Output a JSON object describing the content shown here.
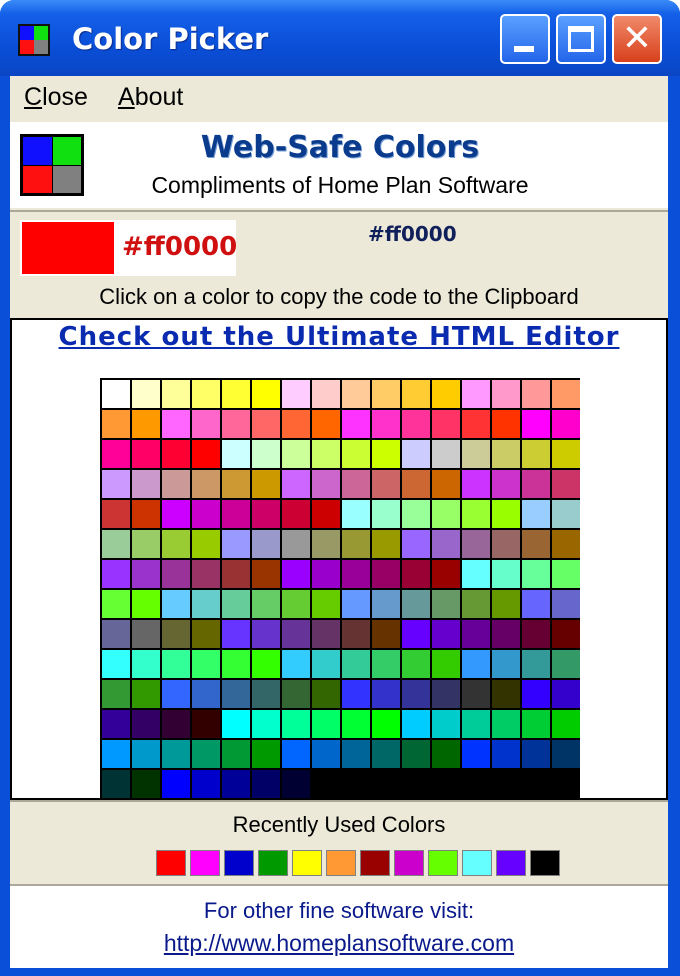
{
  "window": {
    "title": "Color Picker"
  },
  "menu": {
    "close": "Close",
    "about": "About"
  },
  "header": {
    "title": "Web-Safe Colors",
    "subtitle": "Compliments of Home Plan Software"
  },
  "current": {
    "color": "#ff0000",
    "hex_label": "#ff0000",
    "hex_label_alt": "#ff0000"
  },
  "instruction": "Click on a color to copy the code to the Clipboard",
  "promo_link": "Check out the Ultimate HTML Editor",
  "palette": {
    "rows": [
      [
        "#ffffff",
        "#ffffcc",
        "#ffff99",
        "#ffff66",
        "#ffff33",
        "#ffff00",
        "#ffccff",
        "#ffcccc",
        "#ffcc99",
        "#ffcc66",
        "#ffcc33",
        "#ffcc00",
        "#ff99ff",
        "#ff99cc",
        "#ff9999",
        "#ff9966"
      ],
      [
        "#ff9933",
        "#ff9900",
        "#ff66ff",
        "#ff66cc",
        "#ff6699",
        "#ff6666",
        "#ff6633",
        "#ff6600",
        "#ff33ff",
        "#ff33cc",
        "#ff3399",
        "#ff3366",
        "#ff3333",
        "#ff3300",
        "#ff00ff",
        "#ff00cc"
      ],
      [
        "#ff0099",
        "#ff0066",
        "#ff0033",
        "#ff0000",
        "#ccffff",
        "#ccffcc",
        "#ccff99",
        "#ccff66",
        "#ccff33",
        "#ccff00",
        "#ccccff",
        "#cccccc",
        "#cccc99",
        "#cccc66",
        "#cccc33",
        "#cccc00"
      ],
      [
        "#cc99ff",
        "#cc99cc",
        "#cc9999",
        "#cc9966",
        "#cc9933",
        "#cc9900",
        "#cc66ff",
        "#cc66cc",
        "#cc6699",
        "#cc6666",
        "#cc6633",
        "#cc6600",
        "#cc33ff",
        "#cc33cc",
        "#cc3399",
        "#cc3366"
      ],
      [
        "#cc3333",
        "#cc3300",
        "#cc00ff",
        "#cc00cc",
        "#cc0099",
        "#cc0066",
        "#cc0033",
        "#cc0000",
        "#99ffff",
        "#99ffcc",
        "#99ff99",
        "#99ff66",
        "#99ff33",
        "#99ff00",
        "#99ccff",
        "#99cccc"
      ],
      [
        "#99cc99",
        "#99cc66",
        "#99cc33",
        "#99cc00",
        "#9999ff",
        "#9999cc",
        "#999999",
        "#999966",
        "#999933",
        "#999900",
        "#9966ff",
        "#9966cc",
        "#996699",
        "#996666",
        "#996633",
        "#996600"
      ],
      [
        "#9933ff",
        "#9933cc",
        "#993399",
        "#993366",
        "#993333",
        "#993300",
        "#9900ff",
        "#9900cc",
        "#990099",
        "#990066",
        "#990033",
        "#990000",
        "#66ffff",
        "#66ffcc",
        "#66ff99",
        "#66ff66"
      ],
      [
        "#66ff33",
        "#66ff00",
        "#66ccff",
        "#66cccc",
        "#66cc99",
        "#66cc66",
        "#66cc33",
        "#66cc00",
        "#6699ff",
        "#6699cc",
        "#669999",
        "#669966",
        "#669933",
        "#669900",
        "#6666ff",
        "#6666cc"
      ],
      [
        "#666699",
        "#666666",
        "#666633",
        "#666600",
        "#6633ff",
        "#6633cc",
        "#663399",
        "#663366",
        "#663333",
        "#663300",
        "#6600ff",
        "#6600cc",
        "#660099",
        "#660066",
        "#660033",
        "#660000"
      ],
      [
        "#33ffff",
        "#33ffcc",
        "#33ff99",
        "#33ff66",
        "#33ff33",
        "#33ff00",
        "#33ccff",
        "#33cccc",
        "#33cc99",
        "#33cc66",
        "#33cc33",
        "#33cc00",
        "#3399ff",
        "#3399cc",
        "#339999",
        "#339966"
      ],
      [
        "#339933",
        "#339900",
        "#3366ff",
        "#3366cc",
        "#336699",
        "#336666",
        "#336633",
        "#336600",
        "#3333ff",
        "#3333cc",
        "#333399",
        "#333366",
        "#333333",
        "#333300",
        "#3300ff",
        "#3300cc"
      ],
      [
        "#330099",
        "#330066",
        "#330033",
        "#330000",
        "#00ffff",
        "#00ffcc",
        "#00ff99",
        "#00ff66",
        "#00ff33",
        "#00ff00",
        "#00ccff",
        "#00cccc",
        "#00cc99",
        "#00cc66",
        "#00cc33",
        "#00cc00"
      ],
      [
        "#0099ff",
        "#0099cc",
        "#009999",
        "#009966",
        "#009933",
        "#009900",
        "#0066ff",
        "#0066cc",
        "#006699",
        "#006666",
        "#006633",
        "#006600",
        "#0033ff",
        "#0033cc",
        "#003399",
        "#003366"
      ],
      [
        "#003333",
        "#003300",
        "#0000ff",
        "#0000cc",
        "#000099",
        "#000066",
        "#000033",
        "#000000",
        "#000000",
        "#000000",
        "#000000",
        "#000000",
        "#000000",
        "#000000",
        "#000000",
        "#000000"
      ]
    ]
  },
  "recent": {
    "label": "Recently Used Colors",
    "colors": [
      "#ff0000",
      "#ff00ff",
      "#0000cc",
      "#009900",
      "#ffff00",
      "#ff9933",
      "#990000",
      "#cc00cc",
      "#66ff00",
      "#66ffff",
      "#6600ff",
      "#000000"
    ]
  },
  "footer": {
    "text": "For other fine software visit:",
    "link": "http://www.homeplansoftware.com"
  }
}
